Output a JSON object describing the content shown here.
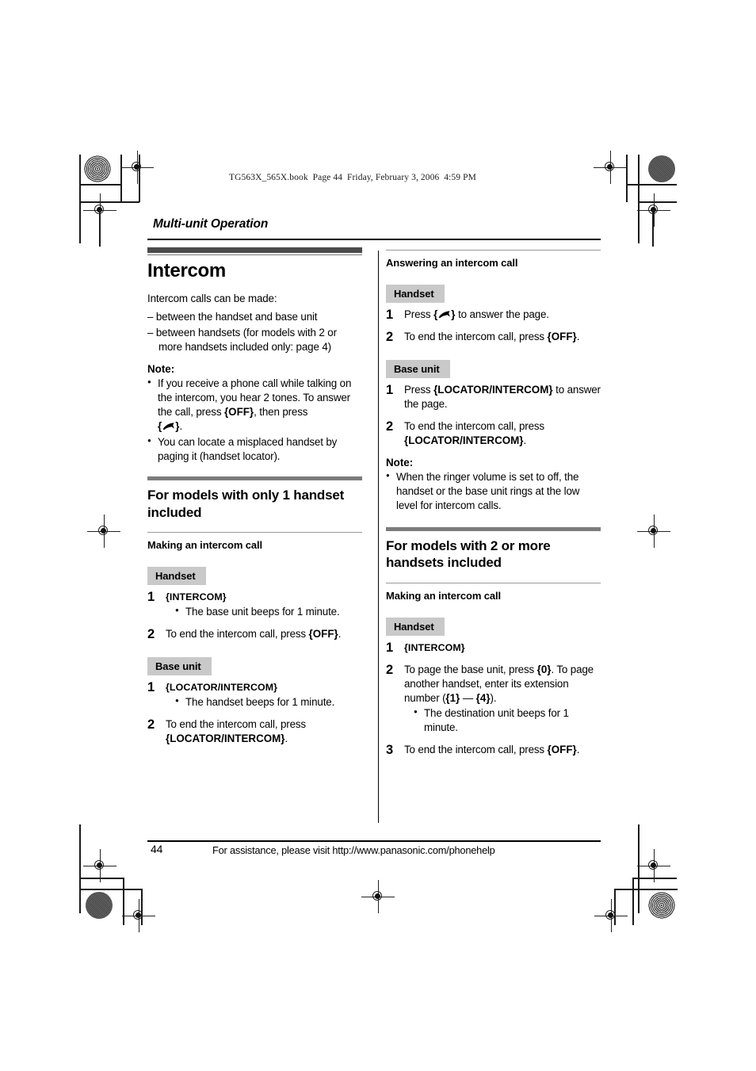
{
  "header": {
    "book_line": "TG563X_565X.book  Page 44  Friday, February 3, 2006  4:59 PM",
    "running_head": "Multi-unit Operation"
  },
  "footer": {
    "page_number": "44",
    "assistance": "For assistance, please visit http://www.panasonic.com/phonehelp"
  },
  "left_column": {
    "chapter_title": "Intercom",
    "intro": "Intercom calls can be made:",
    "dash_items": [
      "– between the handset and base unit",
      "– between handsets (for models with 2 or more handsets included only: page 4)"
    ],
    "note_label": "Note:",
    "notes": [
      {
        "part1": "If you receive a phone call while talking on the intercom, you hear 2 tones. To answer the call, press ",
        "key1": "{OFF}",
        "part2": ", then press ",
        "key2_open": "{",
        "key2_close": "}",
        "part3": "."
      },
      {
        "text": "You can locate a misplaced handset by paging it (handset locator)."
      }
    ],
    "section_title": "For models with only 1 handset included",
    "subsection_title": "Making an intercom call",
    "handset_label": "Handset",
    "base_unit_label": "Base unit",
    "handset_steps": [
      {
        "num": "1",
        "text": "",
        "key": "{INTERCOM}",
        "bullets": [
          "The base unit beeps for 1 minute."
        ]
      },
      {
        "num": "2",
        "text_before": "To end the intercom call, press ",
        "key": "{OFF}",
        "text_after": ".",
        "bullets": []
      }
    ],
    "base_steps": [
      {
        "num": "1",
        "text": "",
        "key": "{LOCATOR/INTERCOM}",
        "bullets": [
          "The handset beeps for 1 minute."
        ]
      },
      {
        "num": "2",
        "text_before": "To end the intercom call, press ",
        "key": "{LOCATOR/INTERCOM}",
        "text_after": ".",
        "bullets": []
      }
    ]
  },
  "right_column": {
    "subsection_title": "Answering an intercom call",
    "handset_label": "Handset",
    "base_unit_label": "Base unit",
    "handset_steps": [
      {
        "num": "1",
        "text_before": "Press ",
        "key_open": "{",
        "key_close": "}",
        "text_after": " to answer the page."
      },
      {
        "num": "2",
        "text_before": "To end the intercom call, press ",
        "key": "{OFF}",
        "text_after": "."
      }
    ],
    "base_steps": [
      {
        "num": "1",
        "text_before": "Press ",
        "key": "{LOCATOR/INTERCOM}",
        "text_after": " to answer the page."
      },
      {
        "num": "2",
        "text_before": "To end the intercom call, press ",
        "key": "{LOCATOR/INTERCOM}",
        "text_after": "."
      }
    ],
    "note_label": "Note:",
    "notes": [
      "When the ringer volume is set to off, the handset or the base unit rings at the low level for intercom calls."
    ],
    "section_title": "For models with 2 or more handsets included",
    "subsection2_title": "Making an intercom call",
    "handset2_label": "Handset",
    "steps2": [
      {
        "num": "1",
        "key": "{INTERCOM}"
      },
      {
        "num": "2",
        "text_before": "To page the base unit, press ",
        "key1": "{0}",
        "text_mid": ". To page another handset, enter its extension number (",
        "key2": "{1}",
        "dash": " — ",
        "key3": "{4}",
        "text_after": ").",
        "bullets": [
          "The destination unit beeps for 1 minute."
        ]
      },
      {
        "num": "3",
        "text_before": "To end the intercom call, press ",
        "key": "{OFF}",
        "text_after": "."
      }
    ]
  },
  "colors": {
    "unit_box_bg": "#c9c9c9",
    "heading_bar_dark": "#4b4b4b",
    "heading_bar_mid": "#7c7c7c",
    "rule_thin": "#9a9a9a",
    "text": "#000000"
  }
}
